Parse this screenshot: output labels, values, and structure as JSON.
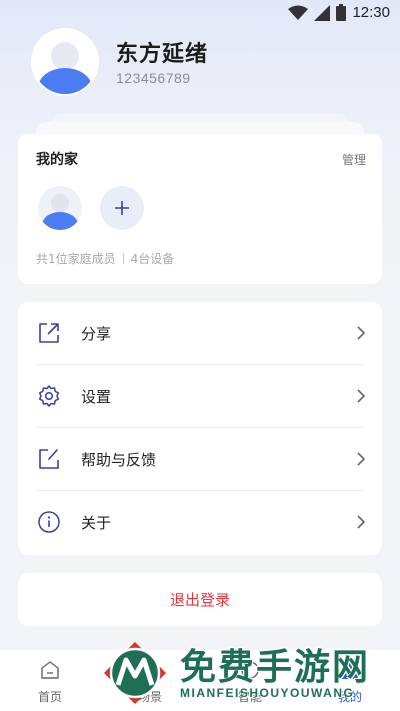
{
  "status_bar": {
    "time": "12:30",
    "icons": [
      "wifi-icon",
      "signal-icon",
      "battery-icon"
    ]
  },
  "profile": {
    "name": "东方延绪",
    "id": "123456789"
  },
  "family": {
    "title": "我的家",
    "manage_label": "管理",
    "members_text": "共1位家庭成员",
    "devices_text": "4台设备"
  },
  "menu": {
    "items": [
      {
        "label": "分享",
        "icon": "share-icon"
      },
      {
        "label": "设置",
        "icon": "gear-icon"
      },
      {
        "label": "帮助与反馈",
        "icon": "edit-icon"
      },
      {
        "label": "关于",
        "icon": "info-icon"
      }
    ]
  },
  "logout_label": "退出登录",
  "bottom_nav": {
    "items": [
      {
        "label": "首页",
        "icon": "home-icon"
      },
      {
        "label": "场景",
        "icon": "scene-icon"
      },
      {
        "label": "智能",
        "icon": "smart-icon"
      },
      {
        "label": "我的",
        "icon": "user-icon"
      }
    ],
    "active_index": 3
  },
  "watermark": {
    "title": "免费手游网",
    "subtitle": "MIANFEISHOUYOUWANG"
  },
  "colors": {
    "accent": "#2b5de0",
    "danger": "#e8363b",
    "icon_stroke": "#3a3fa8",
    "watermark": "#1e6f53"
  }
}
